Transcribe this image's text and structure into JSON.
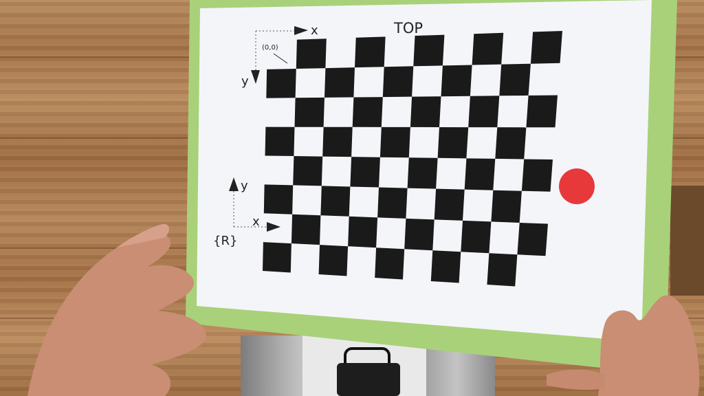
{
  "image": {
    "description_free": true
  },
  "pattern": {
    "title": "TOP",
    "origin_label": "(0,0)",
    "top_x_label": "x",
    "top_y_label": "y",
    "ref_x_label": "x",
    "ref_y_label": "y",
    "ref_frame_label": "{R}"
  },
  "colors": {
    "board_green": "#a9d17a",
    "paper": "#f4f5f9",
    "square": "#1a1a1a",
    "dot": "#e8393a"
  }
}
